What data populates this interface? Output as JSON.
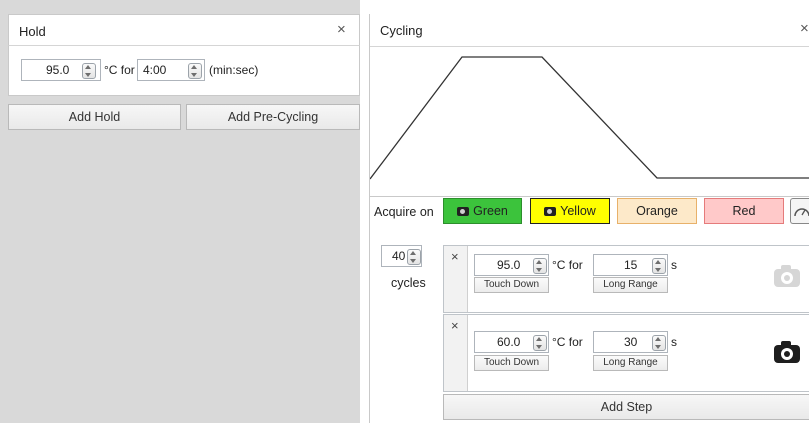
{
  "hold": {
    "title": "Hold",
    "close": "×",
    "temperature": "95.0",
    "temp_unit_for": "°C for",
    "time": "4:00",
    "time_unit": "(min:sec)",
    "add_hold": "Add Hold",
    "add_precycling": "Add Pre-Cycling"
  },
  "cycling": {
    "title": "Cycling",
    "close": "×",
    "acquire_label": "Acquire on",
    "channels": [
      {
        "label": "Green",
        "color": "#3cc33c",
        "has_camera": true
      },
      {
        "label": "Yellow",
        "color": "#ffff00",
        "has_camera": true
      },
      {
        "label": "Orange",
        "color": "#fde9c9",
        "has_camera": false
      },
      {
        "label": "Red",
        "color": "#ffc9c9",
        "has_camera": false
      }
    ],
    "cycles_value": "40",
    "cycles_label": "cycles",
    "steps": [
      {
        "remove": "×",
        "temperature": "95.0",
        "temp_unit_for": "°C for",
        "duration": "15",
        "duration_unit": "s",
        "touch_down": "Touch Down",
        "long_range": "Long Range",
        "acquire": false
      },
      {
        "remove": "×",
        "temperature": "60.0",
        "temp_unit_for": "°C for",
        "duration": "30",
        "duration_unit": "s",
        "touch_down": "Touch Down",
        "long_range": "Long Range",
        "acquire": true
      }
    ],
    "add_step": "Add Step"
  }
}
